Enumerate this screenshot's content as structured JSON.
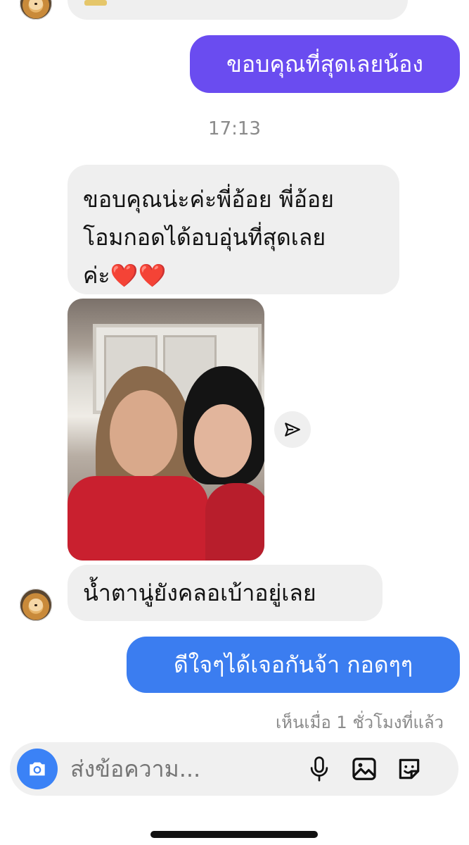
{
  "messages": {
    "out1": {
      "text": "ขอบคุณที่สุดเลยน้อง",
      "color": "#6a4cf0"
    },
    "timestamp": "17:13",
    "in1": {
      "lines": [
        "ขอบคุณน่ะค่ะพี่อ้อย พี่อ้อย",
        "โอมกอดได้อบอุ่นที่สุดเลย",
        "ค่ะ❤️❤️"
      ]
    },
    "in2": {
      "text": "น้ำตานู่ยังคลอเบ้าอยู่เลย"
    },
    "out2": {
      "text": "ดีใจๆได้เจอกันจ้า  กอดๆๆ",
      "color": "#3b7df0"
    },
    "seen": "เห็นเมื่อ 1 ชั่วโมงที่แล้ว"
  },
  "composer": {
    "placeholder": "ส่งข้อความ...",
    "icons": [
      "camera-icon",
      "microphone-icon",
      "image-icon",
      "sticker-icon"
    ]
  },
  "icons": {
    "share": "paper-plane-icon"
  },
  "colors": {
    "camera_button": "#3b82f6",
    "bubble_in": "#efefef"
  }
}
